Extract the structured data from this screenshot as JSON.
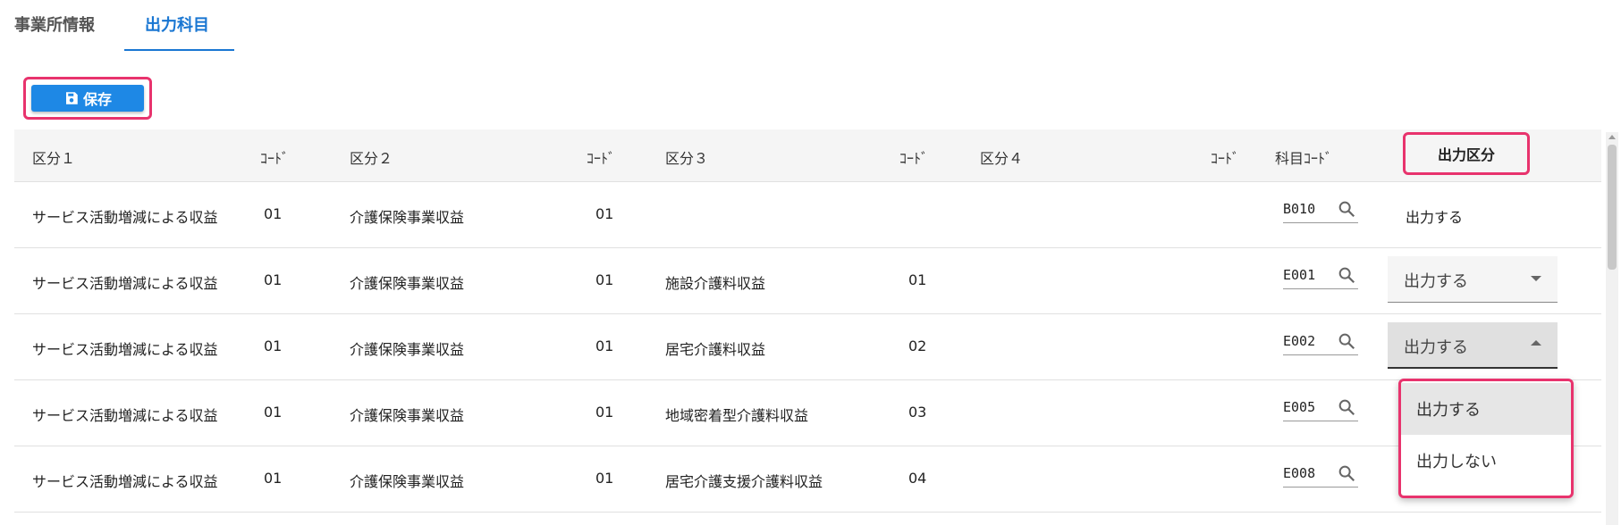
{
  "tabs": [
    {
      "label": "事業所情報"
    },
    {
      "label": "出力科目"
    }
  ],
  "active_tab": "出力科目",
  "toolbar": {
    "save_label": "保存"
  },
  "table": {
    "headers": {
      "k1": "区分１",
      "cd1": "ｺｰﾄﾞ",
      "k2": "区分２",
      "cd2": "ｺｰﾄﾞ",
      "k3": "区分３",
      "cd3": "ｺｰﾄﾞ",
      "k4": "区分４",
      "cd4": "ｺｰﾄﾞ",
      "acct": "科目ｺｰﾄﾞ",
      "out": "出力区分"
    },
    "rows": [
      {
        "k1": "サービス活動増減による収益",
        "cd1": "01",
        "k2": "介護保険事業収益",
        "cd2": "01",
        "k3": "",
        "cd3": "",
        "acct": "B010",
        "out": "出力する"
      },
      {
        "k1": "サービス活動増減による収益",
        "cd1": "01",
        "k2": "介護保険事業収益",
        "cd2": "01",
        "k3": "施設介護料収益",
        "cd3": "01",
        "acct": "E001",
        "out": "出力する"
      },
      {
        "k1": "サービス活動増減による収益",
        "cd1": "01",
        "k2": "介護保険事業収益",
        "cd2": "01",
        "k3": "居宅介護料収益",
        "cd3": "02",
        "acct": "E002",
        "out": "出力する"
      },
      {
        "k1": "サービス活動増減による収益",
        "cd1": "01",
        "k2": "介護保険事業収益",
        "cd2": "01",
        "k3": "地域密着型介護料収益",
        "cd3": "03",
        "acct": "E005",
        "out": "出力する"
      },
      {
        "k1": "サービス活動増減による収益",
        "cd1": "01",
        "k2": "介護保険事業収益",
        "cd2": "01",
        "k3": "居宅介護支援介護料収益",
        "cd3": "04",
        "acct": "E008",
        "out": "出力する"
      }
    ]
  },
  "dropdown": {
    "options": [
      "出力する",
      "出力しない"
    ],
    "selected": "出力する"
  },
  "colors": {
    "accent": "#1976d2",
    "button": "#1e88e5",
    "highlight": "#e8336d"
  },
  "icons": {
    "save": "save-icon",
    "search": "search-icon",
    "dropdown": "chevron-down-icon"
  }
}
